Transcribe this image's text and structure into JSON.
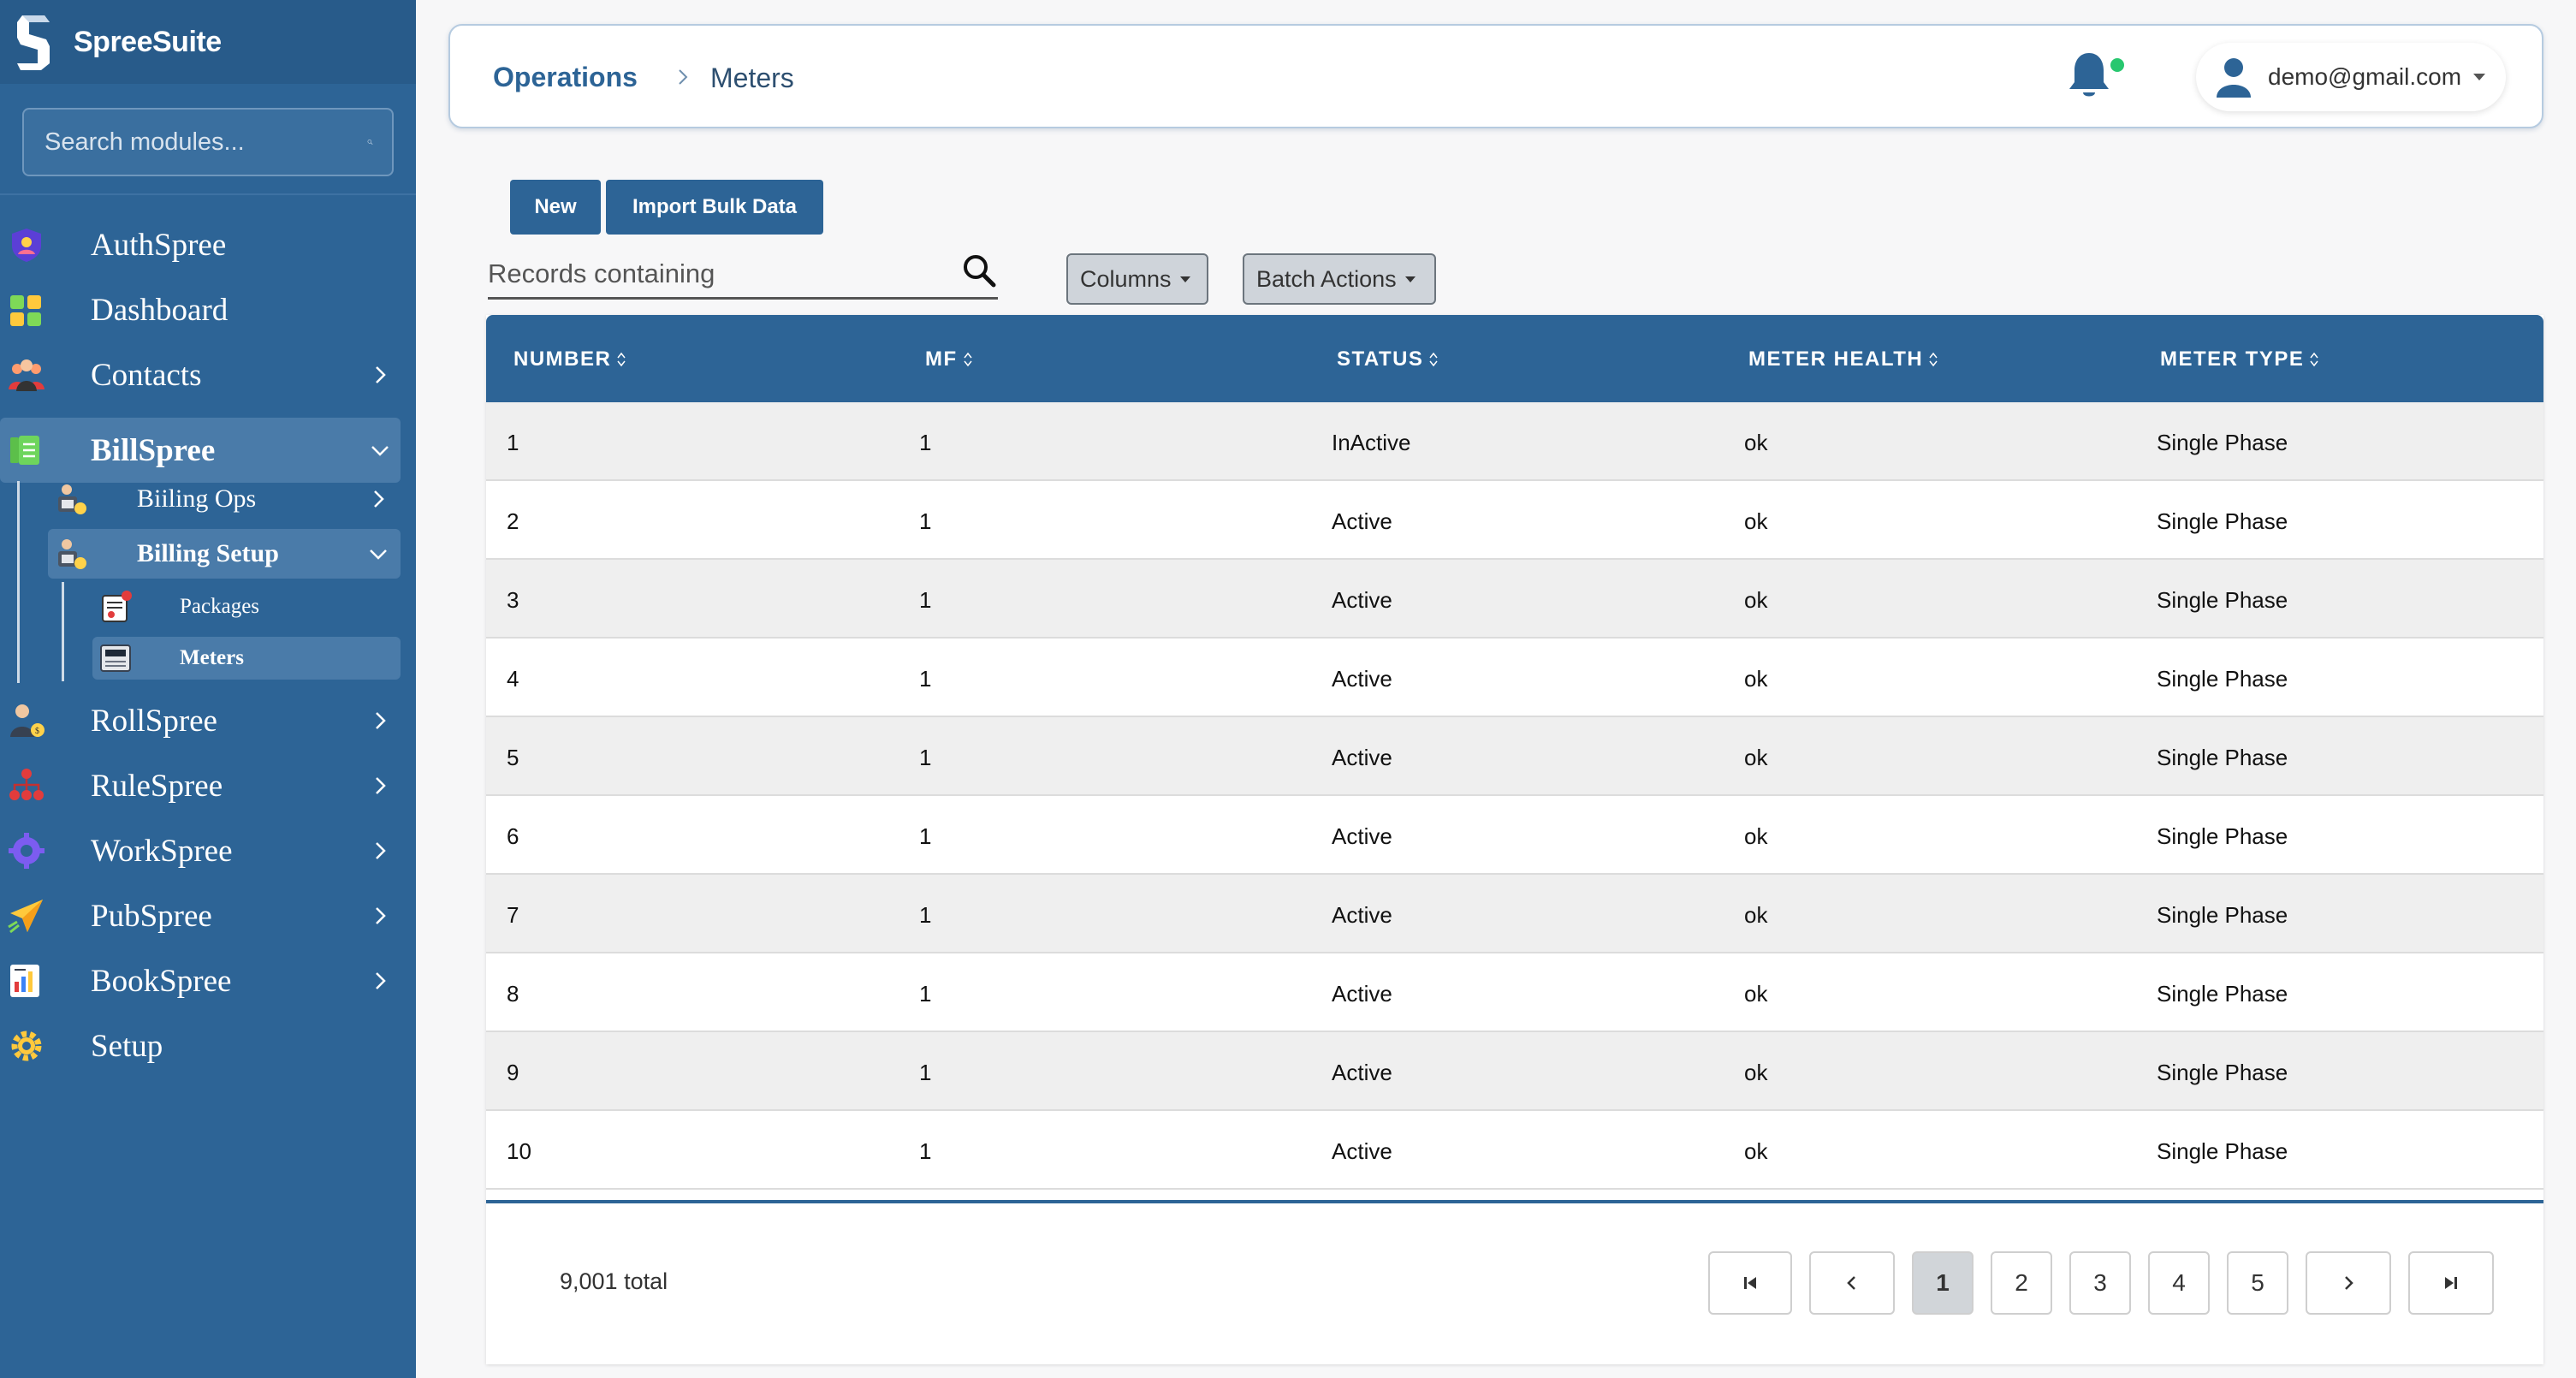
{
  "app": {
    "name": "SpreeSuite"
  },
  "sidebar": {
    "search_placeholder": "Search modules...",
    "items": [
      {
        "label": "AuthSpree",
        "icon": "shield-user-icon",
        "expandable": false
      },
      {
        "label": "Dashboard",
        "icon": "dashboard-grid-icon",
        "expandable": false
      },
      {
        "label": "Contacts",
        "icon": "people-group-icon",
        "expandable": true
      },
      {
        "label": "BillSpree",
        "icon": "bill-document-icon",
        "expandable": true,
        "expanded": true
      },
      {
        "label": "RollSpree",
        "icon": "payroll-person-icon",
        "expandable": true
      },
      {
        "label": "RuleSpree",
        "icon": "hierarchy-icon",
        "expandable": true
      },
      {
        "label": "WorkSpree",
        "icon": "workers-gear-icon",
        "expandable": true
      },
      {
        "label": "PubSpree",
        "icon": "paper-plane-icon",
        "expandable": true
      },
      {
        "label": "BookSpree",
        "icon": "ledger-chart-icon",
        "expandable": true
      },
      {
        "label": "Setup",
        "icon": "gear-icon",
        "expandable": false
      }
    ],
    "billspree_children": [
      {
        "label": "Biiling Ops",
        "icon": "billing-ops-icon",
        "expandable": true
      },
      {
        "label": "Billing Setup",
        "icon": "billing-setup-icon",
        "expandable": true,
        "expanded": true
      }
    ],
    "billing_setup_children": [
      {
        "label": "Packages",
        "icon": "package-icon"
      },
      {
        "label": "Meters",
        "icon": "meter-device-icon",
        "active": true
      }
    ]
  },
  "header": {
    "breadcrumb": [
      "Operations",
      "Meters"
    ],
    "user_email": "demo@gmail.com",
    "notification_dot_color": "#28c76f"
  },
  "toolbar": {
    "new_label": "New",
    "import_label": "Import Bulk Data",
    "search_placeholder": "Records containing",
    "columns_label": "Columns",
    "batch_label": "Batch Actions"
  },
  "table": {
    "columns": [
      "NUMBER",
      "MF",
      "STATUS",
      "METER HEALTH",
      "METER TYPE"
    ],
    "rows": [
      [
        "1",
        "1",
        "InActive",
        "ok",
        "Single Phase"
      ],
      [
        "2",
        "1",
        "Active",
        "ok",
        "Single Phase"
      ],
      [
        "3",
        "1",
        "Active",
        "ok",
        "Single Phase"
      ],
      [
        "4",
        "1",
        "Active",
        "ok",
        "Single Phase"
      ],
      [
        "5",
        "1",
        "Active",
        "ok",
        "Single Phase"
      ],
      [
        "6",
        "1",
        "Active",
        "ok",
        "Single Phase"
      ],
      [
        "7",
        "1",
        "Active",
        "ok",
        "Single Phase"
      ],
      [
        "8",
        "1",
        "Active",
        "ok",
        "Single Phase"
      ],
      [
        "9",
        "1",
        "Active",
        "ok",
        "Single Phase"
      ],
      [
        "10",
        "1",
        "Active",
        "ok",
        "Single Phase"
      ]
    ]
  },
  "pagination": {
    "total_text": "9,001 total",
    "pages": [
      "1",
      "2",
      "3",
      "4",
      "5"
    ],
    "current_page": "1"
  },
  "colors": {
    "brand": "#2d6496",
    "sidebar": "#2d6496",
    "active_nav": "#4a7ba9",
    "row_alt": "#efefef"
  }
}
